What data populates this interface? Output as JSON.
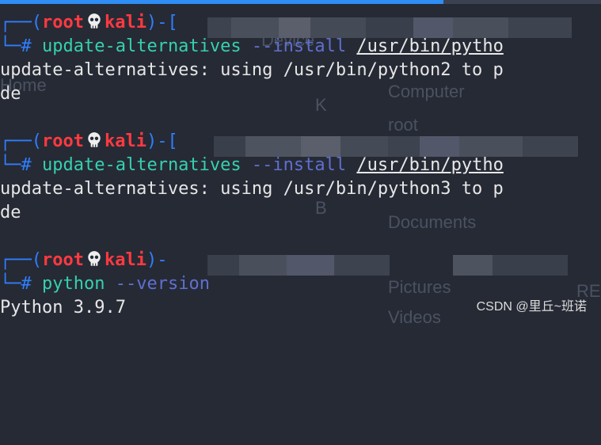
{
  "prompt": {
    "user": "root",
    "host": "kali",
    "symbol": "#"
  },
  "blocks": [
    {
      "command": "update-alternatives",
      "flag": "--install",
      "path": "/usr/bin/pytho",
      "output": [
        "update-alternatives: using /usr/bin/python2 to p",
        "de"
      ]
    },
    {
      "command": "update-alternatives",
      "flag": "--install",
      "path": "/usr/bin/pytho",
      "output": [
        "update-alternatives: using /usr/bin/python3 to p",
        "de"
      ]
    },
    {
      "command": "python",
      "flag": "--version",
      "path": "",
      "output": [
        "Python 3.9.7"
      ]
    }
  ],
  "background": {
    "labels": [
      "Device",
      "Home",
      "Computer",
      "root",
      "Documents",
      "Pictures",
      "Videos",
      "RE",
      "K",
      "B"
    ]
  },
  "watermark": "CSDN @里丘~班诺",
  "colors": {
    "background": "#262a35",
    "prompt_user": "#ff3a40",
    "prompt_frame": "#2f7fff",
    "command": "#35d1b0",
    "flag": "#5f6fcf",
    "output": "#e6e6e6"
  }
}
